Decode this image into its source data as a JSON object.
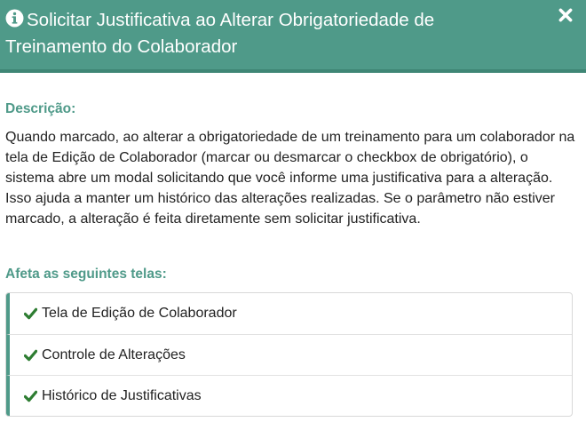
{
  "modal": {
    "title": "Solicitar Justificativa ao Alterar Obrigatoriedade de Treinamento do Colaborador",
    "close_icon": "close-icon",
    "info_icon": "info-circle-icon"
  },
  "description": {
    "heading": "Descrição:",
    "text": "Quando marcado, ao alterar a obrigatoriedade de um treinamento para um colaborador na tela de Edição de Colaborador (marcar ou desmarcar o checkbox de obrigatório), o sistema abre um modal solicitando que você informe uma justificativa para a alteração. Isso ajuda a manter um histórico das alterações realizadas. Se o parâmetro não estiver marcado, a alteração é feita diretamente sem solicitar justificativa."
  },
  "affected_screens": {
    "heading": "Afeta as seguintes telas:",
    "items": [
      {
        "label": "Tela de Edição de Colaborador",
        "icon": "check-icon"
      },
      {
        "label": "Controle de Alterações",
        "icon": "check-icon"
      },
      {
        "label": "Histórico de Justificativas",
        "icon": "check-icon"
      }
    ]
  },
  "colors": {
    "header_bg": "#4f9a89",
    "accent": "#4f9a89",
    "check": "#2e7d32"
  }
}
